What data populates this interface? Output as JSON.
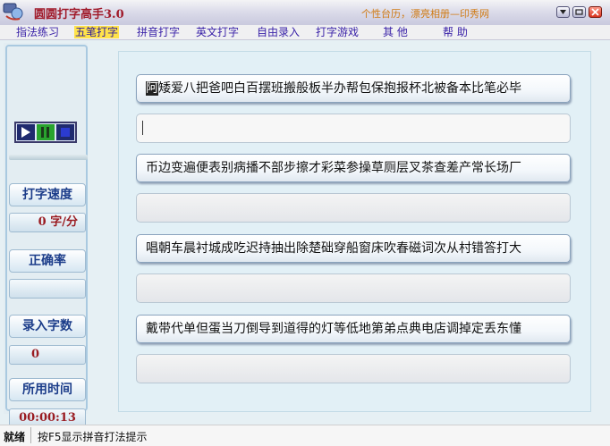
{
  "window": {
    "title": "圆圆打字高手3.0",
    "link_text": "个性台历，漂亮相册—印秀网",
    "buttons": {
      "menu": "menu",
      "minimize": "minimize",
      "close": "close"
    }
  },
  "menu": {
    "items": [
      "指法练习",
      "五笔打字",
      "拼音打字",
      "英文打字",
      "自由录入",
      "打字游戏",
      "其  他",
      "帮  助"
    ],
    "active": "五笔打字"
  },
  "sidebar": {
    "speed_label": "打字速度",
    "speed_value": "0 字/分",
    "accuracy_label": "正确率",
    "accuracy_value": "",
    "count_label": "录入字数",
    "count_value": "0",
    "time_label": "所用时间",
    "time_value": "00:00:13"
  },
  "practice": {
    "lines": [
      {
        "first_char": "阿",
        "rest": "矮爱八把爸吧白百摆班搬般板半办帮包保抱报杯北被备本比笔必毕",
        "typed": ""
      },
      {
        "first_char": "",
        "rest": "币边变遍便表别病播不部步擦才彩菜参操草厕层叉茶查差产常长场厂",
        "typed": ""
      },
      {
        "first_char": "",
        "rest": "唱朝车晨衬城成吃迟持抽出除楚础穿船窗床吹春磁词次从村错答打大",
        "typed": ""
      },
      {
        "first_char": "",
        "rest": "戴带代单但蛋当刀倒导到道得的灯等低地第弟点典电店调掉定丢东懂",
        "typed": ""
      }
    ]
  },
  "status": {
    "ready": "就绪",
    "hint": "按F5显示拼音打法提示"
  },
  "colors": {
    "title_text": "#a01a2a",
    "menu_text": "#3a22a8",
    "menu_active_bg": "#ffe34a",
    "value_text": "#9a1c22",
    "label_text": "#1c3d8a"
  },
  "icons": [
    "app-icon",
    "play-icon",
    "pause-icon",
    "stop-icon",
    "menu-arrow-icon",
    "minimize-icon",
    "close-icon"
  ]
}
